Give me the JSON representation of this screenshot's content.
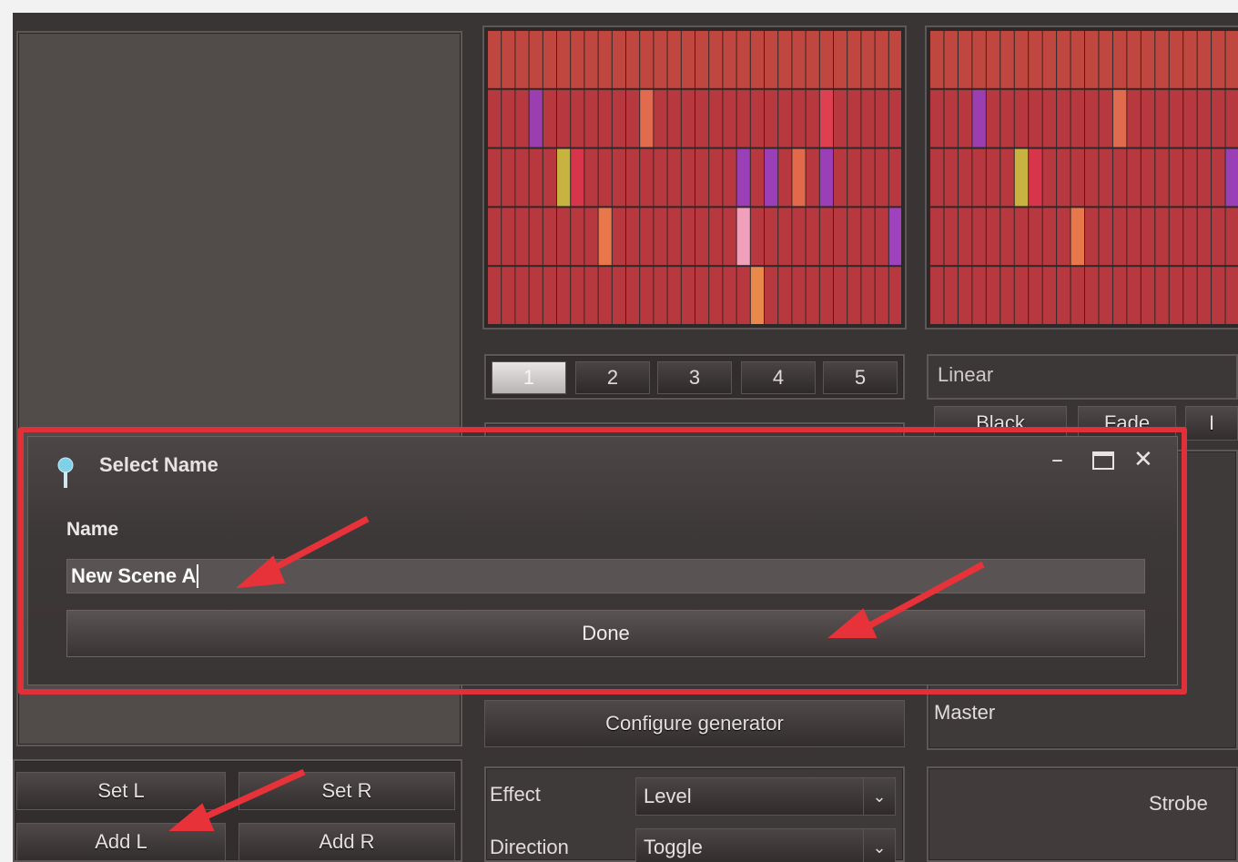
{
  "tabs": [
    "1",
    "2",
    "3",
    "4",
    "5"
  ],
  "active_tab": 0,
  "linear_label": "Linear",
  "mode_buttons": [
    "Black",
    "Fade",
    "I"
  ],
  "configure_generator_label": "Configure generator",
  "master_label": "Master",
  "left_buttons": {
    "set_l": "Set L",
    "set_r": "Set R",
    "add_l": "Add L",
    "add_r": "Add R"
  },
  "effect": {
    "label": "Effect",
    "value": "Level"
  },
  "direction": {
    "label": "Direction",
    "value": "Toggle"
  },
  "strobe_label": "Strobe",
  "dialog": {
    "title": "Select Name",
    "name_label": "Name",
    "name_value": "New Scene A",
    "done_label": "Done",
    "minimize_icon": "minimize-icon",
    "maximize_icon": "maximize-icon",
    "close_icon": "close-icon"
  },
  "colors": {
    "grid_cell": "#b8383f",
    "grid_top_row": "#c0473f",
    "highlight": "#e0313a",
    "arrow": "#e8323a"
  },
  "grid_left": {
    "columns": 30,
    "rows": 5,
    "highlights": [
      {
        "row": 1,
        "col": 3,
        "color": "#9b3fb0"
      },
      {
        "row": 1,
        "col": 11,
        "color": "#e06b4e"
      },
      {
        "row": 1,
        "col": 24,
        "color": "#dd4050"
      },
      {
        "row": 2,
        "col": 5,
        "color": "#c9b340"
      },
      {
        "row": 2,
        "col": 6,
        "color": "#d8344a"
      },
      {
        "row": 2,
        "col": 18,
        "color": "#9a3fb5"
      },
      {
        "row": 2,
        "col": 20,
        "color": "#9a3fb5"
      },
      {
        "row": 2,
        "col": 22,
        "color": "#e26a4a"
      },
      {
        "row": 2,
        "col": 24,
        "color": "#9a3fb5"
      },
      {
        "row": 3,
        "col": 8,
        "color": "#e8784c"
      },
      {
        "row": 3,
        "col": 18,
        "color": "#f0a0bb"
      },
      {
        "row": 3,
        "col": 29,
        "color": "#a042c0"
      },
      {
        "row": 4,
        "col": 19,
        "color": "#e8884a"
      }
    ]
  },
  "grid_right": {
    "columns": 22,
    "rows": 5,
    "highlights": [
      {
        "row": 1,
        "col": 3,
        "color": "#9b3fb0"
      },
      {
        "row": 1,
        "col": 13,
        "color": "#e06b4e"
      },
      {
        "row": 2,
        "col": 6,
        "color": "#c9b340"
      },
      {
        "row": 2,
        "col": 7,
        "color": "#d8344a"
      },
      {
        "row": 3,
        "col": 10,
        "color": "#e8784c"
      },
      {
        "row": 2,
        "col": 21,
        "color": "#9a3fb5"
      }
    ]
  }
}
